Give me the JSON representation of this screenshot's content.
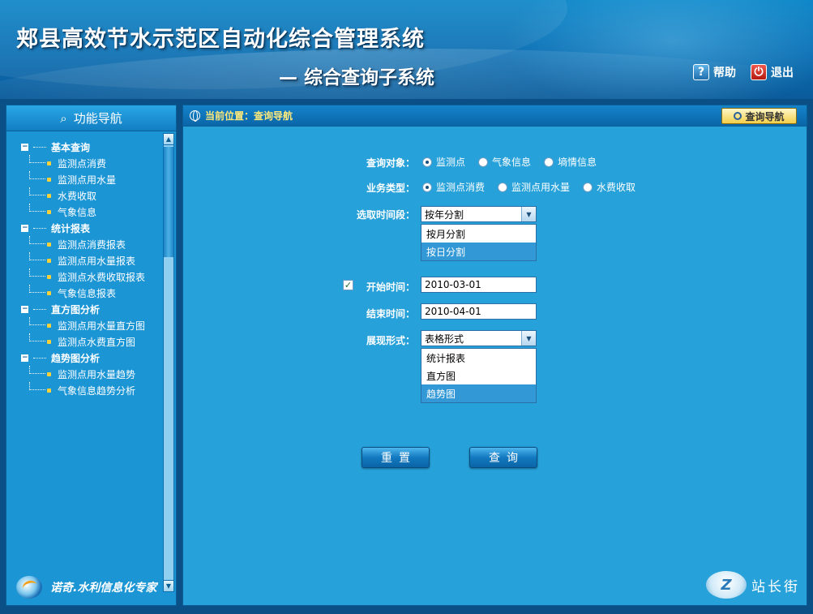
{
  "header": {
    "title": "郏县高效节水示范区自动化综合管理系统",
    "subtitle": "— 综合查询子系统",
    "help_label": "帮助",
    "exit_label": "退出"
  },
  "sidebar": {
    "title": "功能导航",
    "groups": [
      {
        "label": "基本查询",
        "items": [
          "监测点消费",
          "监测点用水量",
          "水费收取",
          "气象信息"
        ]
      },
      {
        "label": "统计报表",
        "items": [
          "监测点消费报表",
          "监测点用水量报表",
          "监测点水费收取报表",
          "气象信息报表"
        ]
      },
      {
        "label": "直方图分析",
        "items": [
          "监测点用水量直方图",
          "监测点水费直方图"
        ]
      },
      {
        "label": "趋势图分析",
        "items": [
          "监测点用水量趋势",
          "气象信息趋势分析"
        ]
      }
    ],
    "footer": "诺奇.水利信息化专家"
  },
  "main": {
    "breadcrumb": "当前位置：查询导航",
    "nav_button": "查询导航",
    "form": {
      "query_object_label": "查询对象：",
      "query_object_options": [
        "监测点",
        "气象信息",
        "墒情信息"
      ],
      "query_object_selected": "监测点",
      "business_type_label": "业务类型：",
      "business_type_options": [
        "监测点消费",
        "监测点用水量",
        "水费收取"
      ],
      "business_type_selected": "监测点消费",
      "period_label": "选取时间段：",
      "period_value": "按年分割",
      "period_options": [
        "按月分割",
        "按日分割"
      ],
      "period_highlighted": "按日分割",
      "start_label": "开始时间：",
      "start_checked": true,
      "start_value": "2010-03-01",
      "end_label": "结束时间：",
      "end_value": "2010-04-01",
      "display_label": "展现形式：",
      "display_value": "表格形式",
      "display_options": [
        "统计报表",
        "直方图",
        "趋势图"
      ],
      "display_highlighted": "趋势图",
      "reset_label": "重置",
      "query_label": "查询"
    }
  },
  "watermark": "站长街"
}
